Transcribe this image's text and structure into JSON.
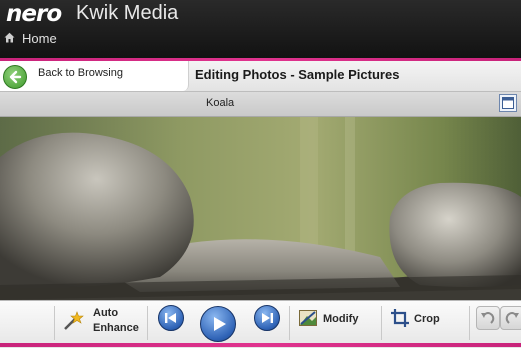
{
  "header": {
    "logo": "nero",
    "app_name": "Kwik Media",
    "home_label": "Home"
  },
  "titlebar": {
    "back_label": "Back to Browsing",
    "page_title": "Editing Photos - Sample Pictures"
  },
  "image": {
    "name": "Koala"
  },
  "toolbar": {
    "auto_enhance_line1": "Auto",
    "auto_enhance_line2": "Enhance",
    "modify_label": "Modify",
    "crop_label": "Crop"
  },
  "colors": {
    "accent_pink": "#d62b84",
    "nav_blue": "#2f63b6",
    "back_green": "#3f9a2c"
  },
  "icons": [
    "home-icon",
    "back-arrow-icon",
    "panel-icon",
    "magic-wand-icon",
    "previous-icon",
    "play-icon",
    "next-icon",
    "modify-icon",
    "crop-icon",
    "rotate-left-icon",
    "rotate-right-icon"
  ]
}
